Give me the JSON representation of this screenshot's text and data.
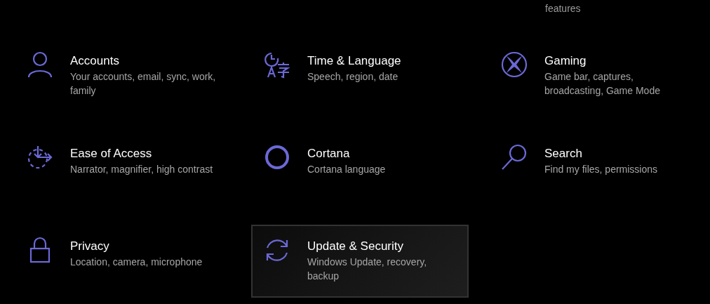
{
  "top_fragment": {
    "text": "features"
  },
  "tiles": [
    {
      "title": "Accounts",
      "description": "Your accounts, email, sync, work, family",
      "selected": false
    },
    {
      "title": "Time & Language",
      "description": "Speech, region, date",
      "selected": false
    },
    {
      "title": "Gaming",
      "description": "Game bar, captures, broadcasting, Game Mode",
      "selected": false
    },
    {
      "title": "Ease of Access",
      "description": "Narrator, magnifier, high contrast",
      "selected": false
    },
    {
      "title": "Cortana",
      "description": "Cortana language",
      "selected": false
    },
    {
      "title": "Search",
      "description": "Find my files, permissions",
      "selected": false
    },
    {
      "title": "Privacy",
      "description": "Location, camera, microphone",
      "selected": false
    },
    {
      "title": "Update & Security",
      "description": "Windows Update, recovery, backup",
      "selected": true
    }
  ]
}
